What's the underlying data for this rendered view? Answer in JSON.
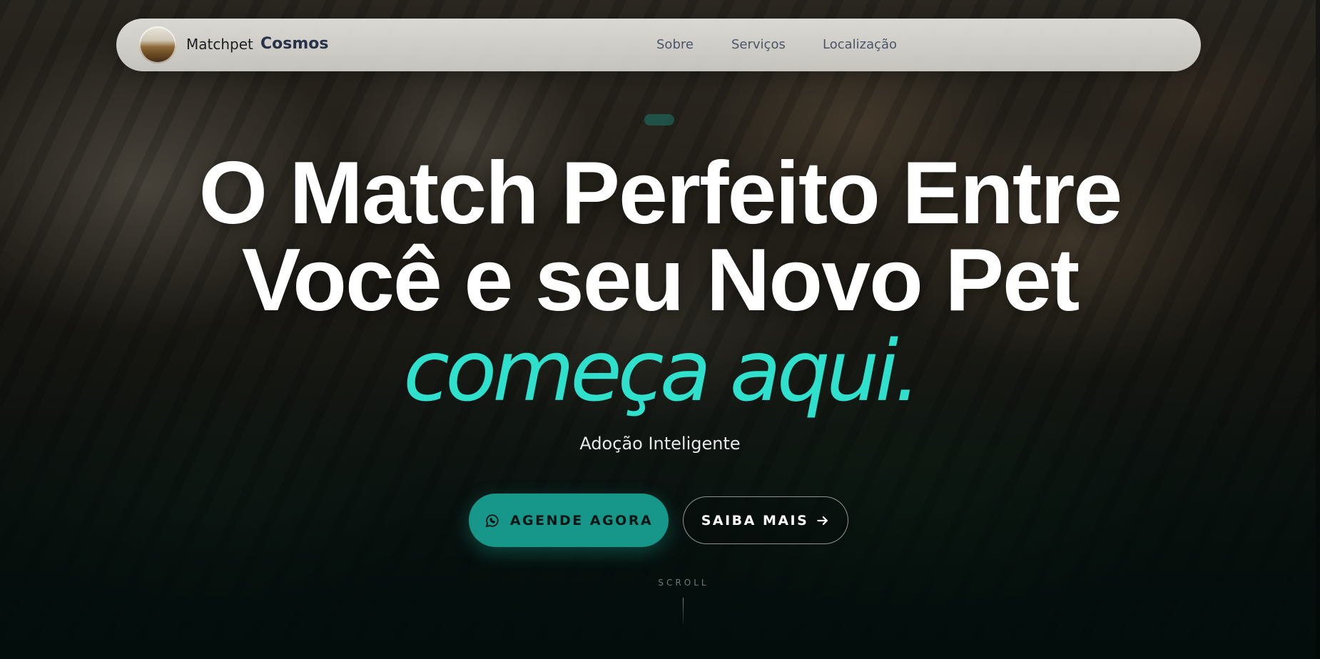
{
  "navbar": {
    "brand_name": "Matchpet",
    "brand_sub": "Cosmos",
    "links": [
      "Sobre",
      "Serviços",
      "Localização"
    ]
  },
  "hero": {
    "headline_line1": "O Match Perfeito Entre",
    "headline_line2": "Você e seu Novo Pet",
    "accent": "começa aqui.",
    "tagline": "Adoção Inteligente",
    "primary_button": "AGENDE AGORA",
    "primary_button_icon": "whatsapp-icon",
    "secondary_button": "SAIBA MAIS",
    "secondary_button_icon": "arrow-right-icon",
    "scroll_label": "SCROLL"
  },
  "colors": {
    "accent": "#2fe0cc",
    "primary_button": "#17968a",
    "navbar": "#e0deda",
    "headline": "#ffffff"
  }
}
